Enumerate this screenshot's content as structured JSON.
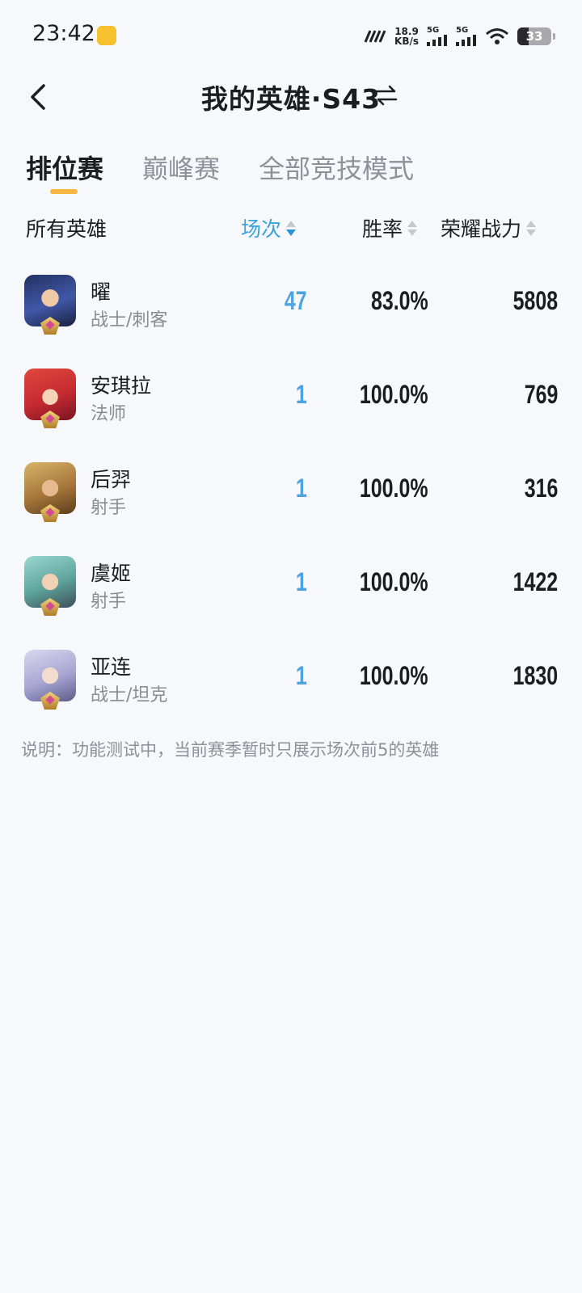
{
  "status": {
    "time": "23:42",
    "net_speed_value": "18.9",
    "net_speed_unit": "KB/s",
    "sim1_label": "5G",
    "sim2_label": "5G",
    "battery": "33"
  },
  "header": {
    "title": "我的英雄·S43"
  },
  "tabs": [
    {
      "label": "排位赛",
      "active": true
    },
    {
      "label": "巅峰赛",
      "active": false
    },
    {
      "label": "全部竞技模式",
      "active": false
    }
  ],
  "columns": {
    "heroes": "所有英雄",
    "matches": "场次",
    "winrate": "胜率",
    "power": "荣耀战力"
  },
  "heroes": [
    {
      "name": "曜",
      "role": "战士/刺客",
      "matches": "47",
      "winrate": "83.0%",
      "power": "5808"
    },
    {
      "name": "安琪拉",
      "role": "法师",
      "matches": "1",
      "winrate": "100.0%",
      "power": "769"
    },
    {
      "name": "后羿",
      "role": "射手",
      "matches": "1",
      "winrate": "100.0%",
      "power": "316"
    },
    {
      "name": "虞姬",
      "role": "射手",
      "matches": "1",
      "winrate": "100.0%",
      "power": "1422"
    },
    {
      "name": "亚连",
      "role": "战士/坦克",
      "matches": "1",
      "winrate": "100.0%",
      "power": "1830"
    }
  ],
  "note": "说明：功能测试中，当前赛季暂时只展示场次前5的英雄",
  "colors": {
    "accent": "#3aa2dc",
    "tab_indicator": "#f5b740",
    "background": "#f7f8fc"
  }
}
